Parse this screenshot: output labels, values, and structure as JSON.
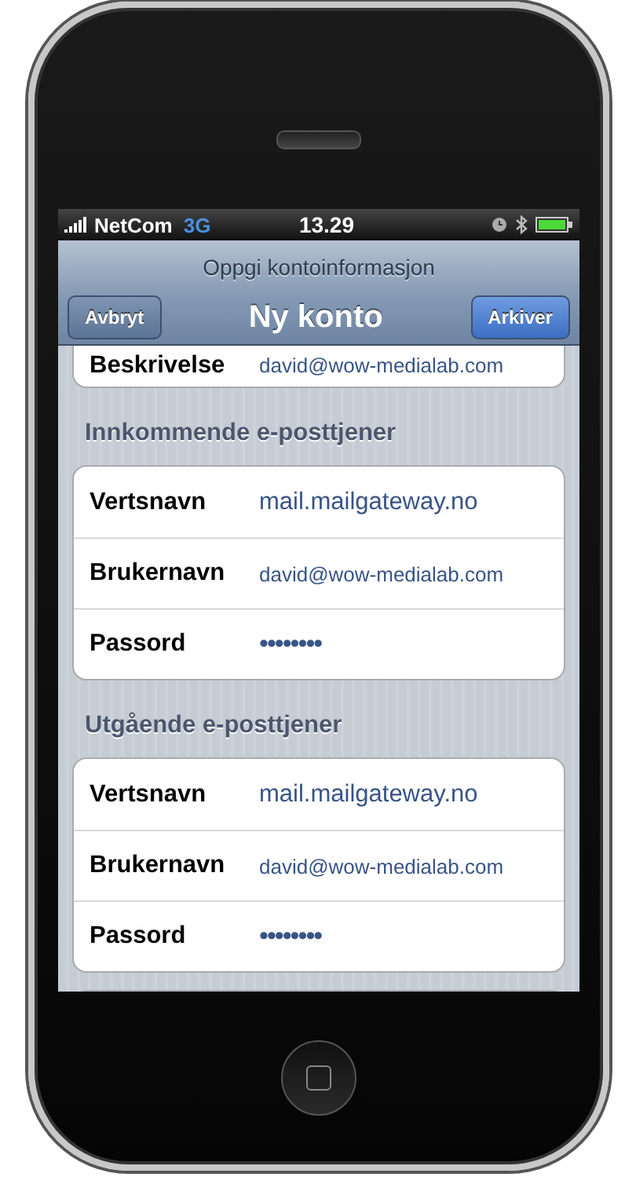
{
  "status_bar": {
    "carrier": "NetCom",
    "network": "3G",
    "time": "13.29"
  },
  "nav_bar": {
    "prompt": "Oppgi kontoinformasjon",
    "title": "Ny konto",
    "left_button": "Avbryt",
    "right_button": "Arkiver"
  },
  "top_row": {
    "label": "Beskrivelse",
    "value": "david@wow-medialab.com"
  },
  "sections": [
    {
      "header": "Innkommende e-posttjener",
      "rows": [
        {
          "label": "Vertsnavn",
          "value": "mail.mailgateway.no",
          "kind": "text"
        },
        {
          "label": "Brukernavn",
          "value": "david@wow-medialab.com",
          "kind": "email"
        },
        {
          "label": "Passord",
          "value": "••••••••",
          "kind": "password"
        }
      ]
    },
    {
      "header": "Utgående e-posttjener",
      "rows": [
        {
          "label": "Vertsnavn",
          "value": "mail.mailgateway.no",
          "kind": "text"
        },
        {
          "label": "Brukernavn",
          "value": "david@wow-medialab.com",
          "kind": "email"
        },
        {
          "label": "Passord",
          "value": "••••••••",
          "kind": "password"
        }
      ]
    }
  ]
}
